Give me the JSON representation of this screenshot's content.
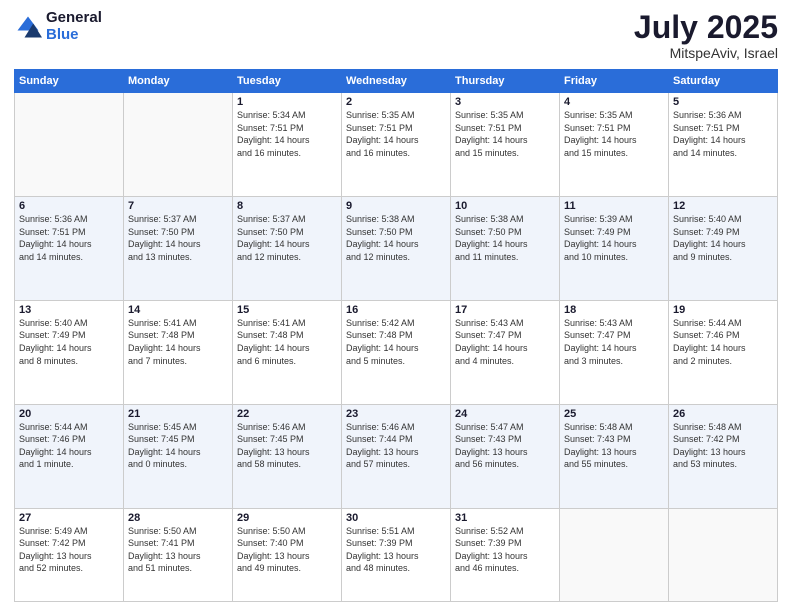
{
  "logo": {
    "general": "General",
    "blue": "Blue"
  },
  "header": {
    "month": "July 2025",
    "location": "MitspeAviv, Israel"
  },
  "weekdays": [
    "Sunday",
    "Monday",
    "Tuesday",
    "Wednesday",
    "Thursday",
    "Friday",
    "Saturday"
  ],
  "weeks": [
    [
      {
        "day": "",
        "info": ""
      },
      {
        "day": "",
        "info": ""
      },
      {
        "day": "1",
        "info": "Sunrise: 5:34 AM\nSunset: 7:51 PM\nDaylight: 14 hours\nand 16 minutes."
      },
      {
        "day": "2",
        "info": "Sunrise: 5:35 AM\nSunset: 7:51 PM\nDaylight: 14 hours\nand 16 minutes."
      },
      {
        "day": "3",
        "info": "Sunrise: 5:35 AM\nSunset: 7:51 PM\nDaylight: 14 hours\nand 15 minutes."
      },
      {
        "day": "4",
        "info": "Sunrise: 5:35 AM\nSunset: 7:51 PM\nDaylight: 14 hours\nand 15 minutes."
      },
      {
        "day": "5",
        "info": "Sunrise: 5:36 AM\nSunset: 7:51 PM\nDaylight: 14 hours\nand 14 minutes."
      }
    ],
    [
      {
        "day": "6",
        "info": "Sunrise: 5:36 AM\nSunset: 7:51 PM\nDaylight: 14 hours\nand 14 minutes."
      },
      {
        "day": "7",
        "info": "Sunrise: 5:37 AM\nSunset: 7:50 PM\nDaylight: 14 hours\nand 13 minutes."
      },
      {
        "day": "8",
        "info": "Sunrise: 5:37 AM\nSunset: 7:50 PM\nDaylight: 14 hours\nand 12 minutes."
      },
      {
        "day": "9",
        "info": "Sunrise: 5:38 AM\nSunset: 7:50 PM\nDaylight: 14 hours\nand 12 minutes."
      },
      {
        "day": "10",
        "info": "Sunrise: 5:38 AM\nSunset: 7:50 PM\nDaylight: 14 hours\nand 11 minutes."
      },
      {
        "day": "11",
        "info": "Sunrise: 5:39 AM\nSunset: 7:49 PM\nDaylight: 14 hours\nand 10 minutes."
      },
      {
        "day": "12",
        "info": "Sunrise: 5:40 AM\nSunset: 7:49 PM\nDaylight: 14 hours\nand 9 minutes."
      }
    ],
    [
      {
        "day": "13",
        "info": "Sunrise: 5:40 AM\nSunset: 7:49 PM\nDaylight: 14 hours\nand 8 minutes."
      },
      {
        "day": "14",
        "info": "Sunrise: 5:41 AM\nSunset: 7:48 PM\nDaylight: 14 hours\nand 7 minutes."
      },
      {
        "day": "15",
        "info": "Sunrise: 5:41 AM\nSunset: 7:48 PM\nDaylight: 14 hours\nand 6 minutes."
      },
      {
        "day": "16",
        "info": "Sunrise: 5:42 AM\nSunset: 7:48 PM\nDaylight: 14 hours\nand 5 minutes."
      },
      {
        "day": "17",
        "info": "Sunrise: 5:43 AM\nSunset: 7:47 PM\nDaylight: 14 hours\nand 4 minutes."
      },
      {
        "day": "18",
        "info": "Sunrise: 5:43 AM\nSunset: 7:47 PM\nDaylight: 14 hours\nand 3 minutes."
      },
      {
        "day": "19",
        "info": "Sunrise: 5:44 AM\nSunset: 7:46 PM\nDaylight: 14 hours\nand 2 minutes."
      }
    ],
    [
      {
        "day": "20",
        "info": "Sunrise: 5:44 AM\nSunset: 7:46 PM\nDaylight: 14 hours\nand 1 minute."
      },
      {
        "day": "21",
        "info": "Sunrise: 5:45 AM\nSunset: 7:45 PM\nDaylight: 14 hours\nand 0 minutes."
      },
      {
        "day": "22",
        "info": "Sunrise: 5:46 AM\nSunset: 7:45 PM\nDaylight: 13 hours\nand 58 minutes."
      },
      {
        "day": "23",
        "info": "Sunrise: 5:46 AM\nSunset: 7:44 PM\nDaylight: 13 hours\nand 57 minutes."
      },
      {
        "day": "24",
        "info": "Sunrise: 5:47 AM\nSunset: 7:43 PM\nDaylight: 13 hours\nand 56 minutes."
      },
      {
        "day": "25",
        "info": "Sunrise: 5:48 AM\nSunset: 7:43 PM\nDaylight: 13 hours\nand 55 minutes."
      },
      {
        "day": "26",
        "info": "Sunrise: 5:48 AM\nSunset: 7:42 PM\nDaylight: 13 hours\nand 53 minutes."
      }
    ],
    [
      {
        "day": "27",
        "info": "Sunrise: 5:49 AM\nSunset: 7:42 PM\nDaylight: 13 hours\nand 52 minutes."
      },
      {
        "day": "28",
        "info": "Sunrise: 5:50 AM\nSunset: 7:41 PM\nDaylight: 13 hours\nand 51 minutes."
      },
      {
        "day": "29",
        "info": "Sunrise: 5:50 AM\nSunset: 7:40 PM\nDaylight: 13 hours\nand 49 minutes."
      },
      {
        "day": "30",
        "info": "Sunrise: 5:51 AM\nSunset: 7:39 PM\nDaylight: 13 hours\nand 48 minutes."
      },
      {
        "day": "31",
        "info": "Sunrise: 5:52 AM\nSunset: 7:39 PM\nDaylight: 13 hours\nand 46 minutes."
      },
      {
        "day": "",
        "info": ""
      },
      {
        "day": "",
        "info": ""
      }
    ]
  ]
}
